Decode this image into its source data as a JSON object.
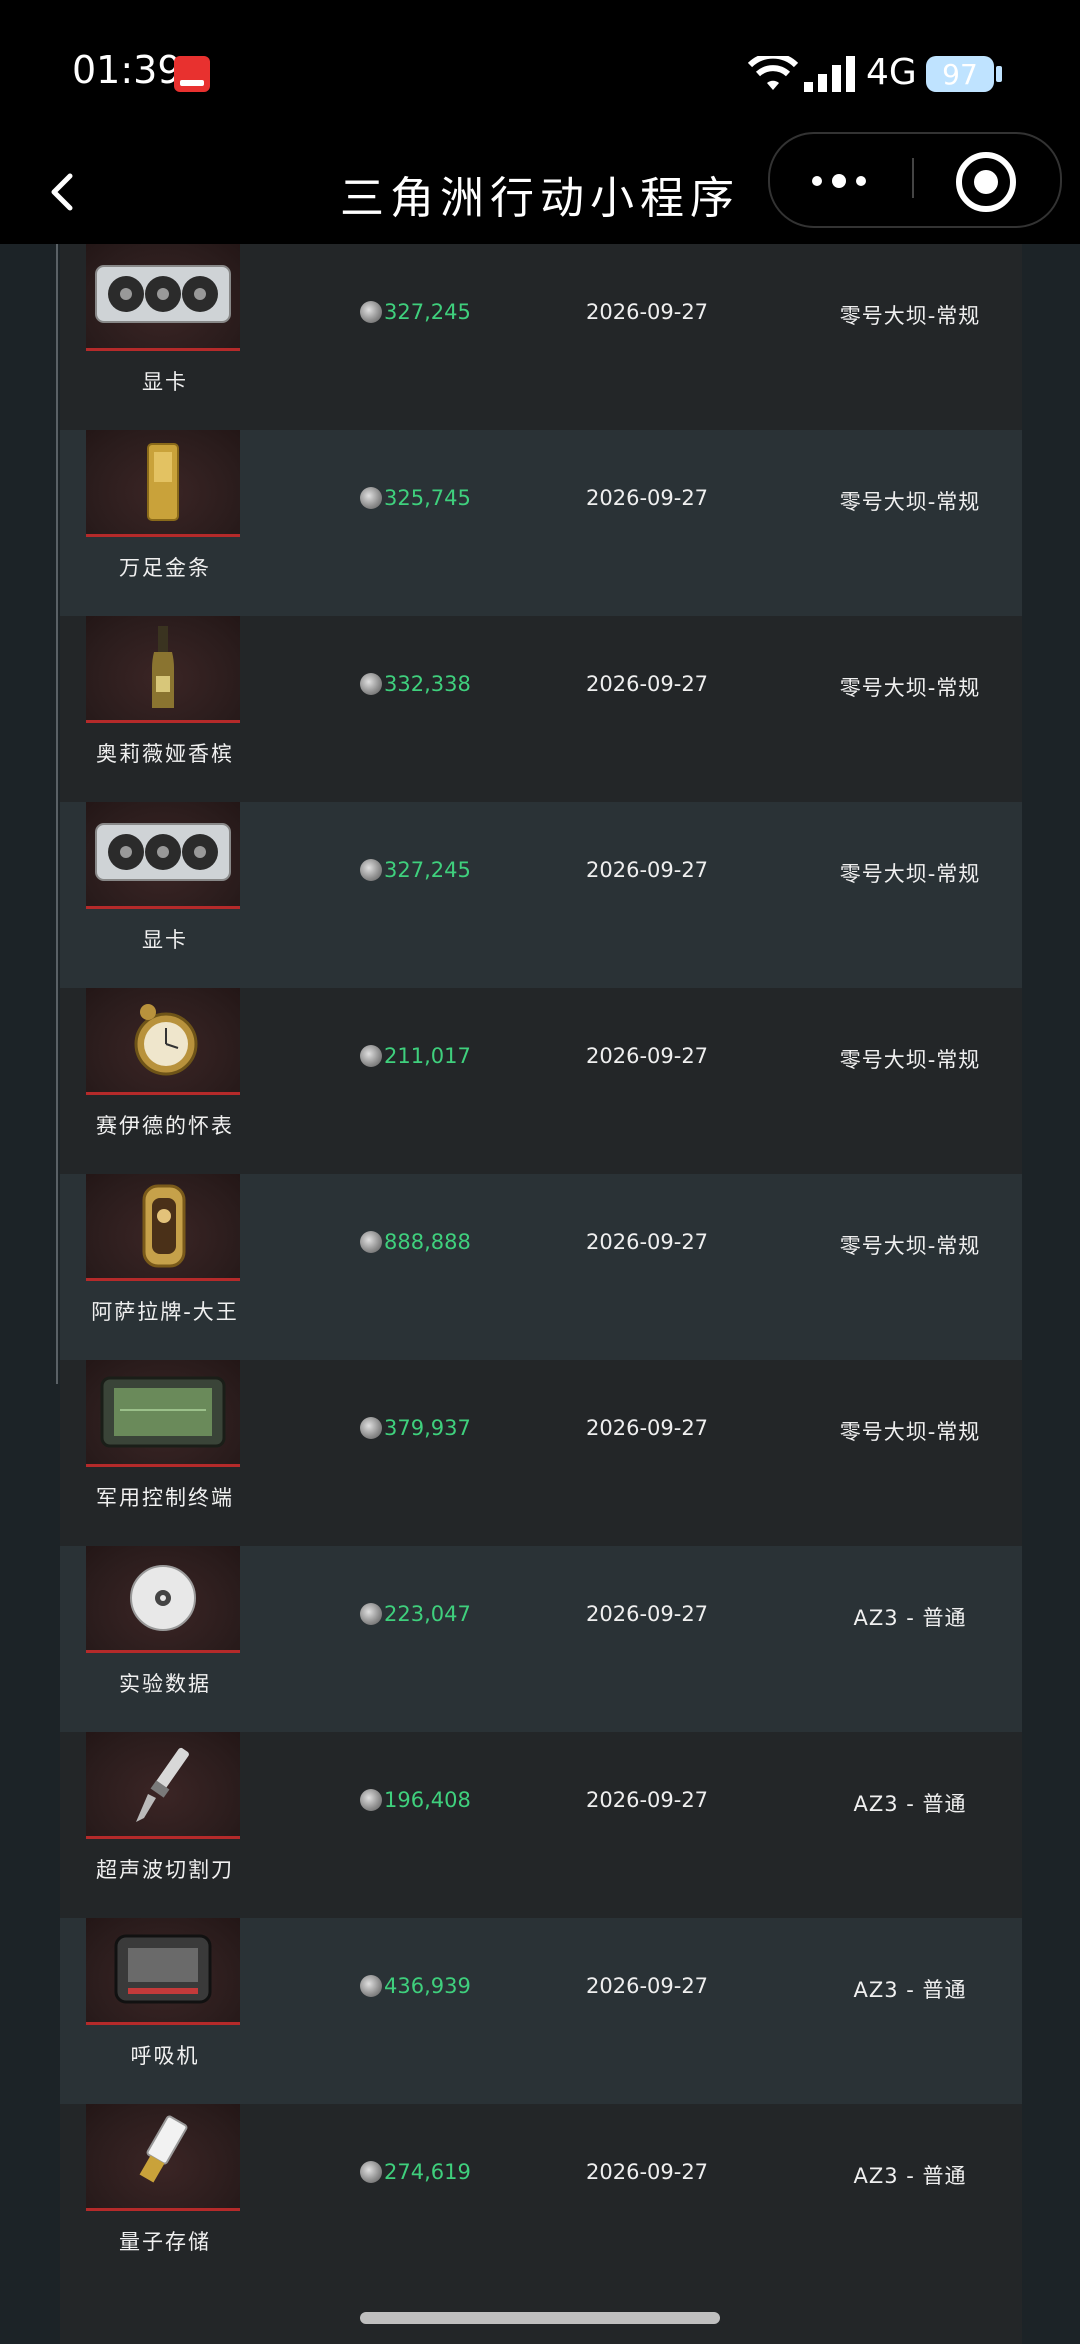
{
  "status_bar": {
    "time": "01:39",
    "network": "4G",
    "battery": "97",
    "app_badge": "小红书"
  },
  "nav": {
    "title": "三角洲行动小程序"
  },
  "rows": [
    {
      "name": "显卡",
      "price": "327,245",
      "date": "2026-09-27",
      "map": "零号大坝-常规",
      "icon": "graphics-card-icon"
    },
    {
      "name": "万足金条",
      "price": "325,745",
      "date": "2026-09-27",
      "map": "零号大坝-常规",
      "icon": "gold-bar-icon"
    },
    {
      "name": "奥莉薇娅香槟",
      "price": "332,338",
      "date": "2026-09-27",
      "map": "零号大坝-常规",
      "icon": "champagne-bottle-icon"
    },
    {
      "name": "显卡",
      "price": "327,245",
      "date": "2026-09-27",
      "map": "零号大坝-常规",
      "icon": "graphics-card-icon"
    },
    {
      "name": "赛伊德的怀表",
      "price": "211,017",
      "date": "2026-09-27",
      "map": "零号大坝-常规",
      "icon": "pocket-watch-icon"
    },
    {
      "name": "阿萨拉牌-大王",
      "price": "888,888",
      "date": "2026-09-27",
      "map": "零号大坝-常规",
      "icon": "playing-card-icon"
    },
    {
      "name": "军用控制终端",
      "price": "379,937",
      "date": "2026-09-27",
      "map": "零号大坝-常规",
      "icon": "control-terminal-icon"
    },
    {
      "name": "实验数据",
      "price": "223,047",
      "date": "2026-09-27",
      "map": "AZ3 - 普通",
      "icon": "disc-icon"
    },
    {
      "name": "超声波切割刀",
      "price": "196,408",
      "date": "2026-09-27",
      "map": "AZ3 - 普通",
      "icon": "ultrasonic-knife-icon"
    },
    {
      "name": "呼吸机",
      "price": "436,939",
      "date": "2026-09-27",
      "map": "AZ3 - 普通",
      "icon": "ventilator-icon"
    },
    {
      "name": "量子存储",
      "price": "274,619",
      "date": "2026-09-27",
      "map": "AZ3 - 普通",
      "icon": "quantum-storage-icon"
    }
  ]
}
